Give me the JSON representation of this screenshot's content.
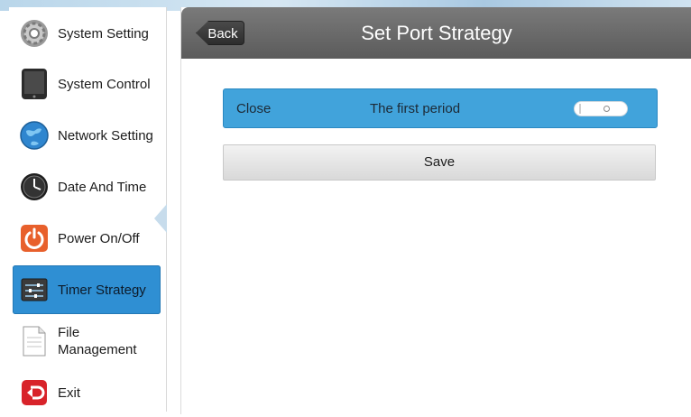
{
  "sidebar": {
    "items": [
      {
        "label": "System Setting",
        "icon": "gear-icon"
      },
      {
        "label": "System Control",
        "icon": "tablet-icon"
      },
      {
        "label": "Network Setting",
        "icon": "globe-icon"
      },
      {
        "label": "Date And Time",
        "icon": "clock-icon"
      },
      {
        "label": "Power On/Off",
        "icon": "power-icon"
      },
      {
        "label": "Timer Strategy",
        "icon": "sliders-icon",
        "active": true
      },
      {
        "label": "File Management",
        "icon": "document-icon"
      },
      {
        "label": "Exit",
        "icon": "exit-icon"
      }
    ]
  },
  "header": {
    "back_label": "Back",
    "title": "Set Port Strategy"
  },
  "period": {
    "state_label": "Close",
    "name": "The first period",
    "toggle_on": false
  },
  "save_label": "Save",
  "colors": {
    "accent": "#41a3db",
    "active_item": "#2f8fd3",
    "header": "#6b6b6b"
  }
}
